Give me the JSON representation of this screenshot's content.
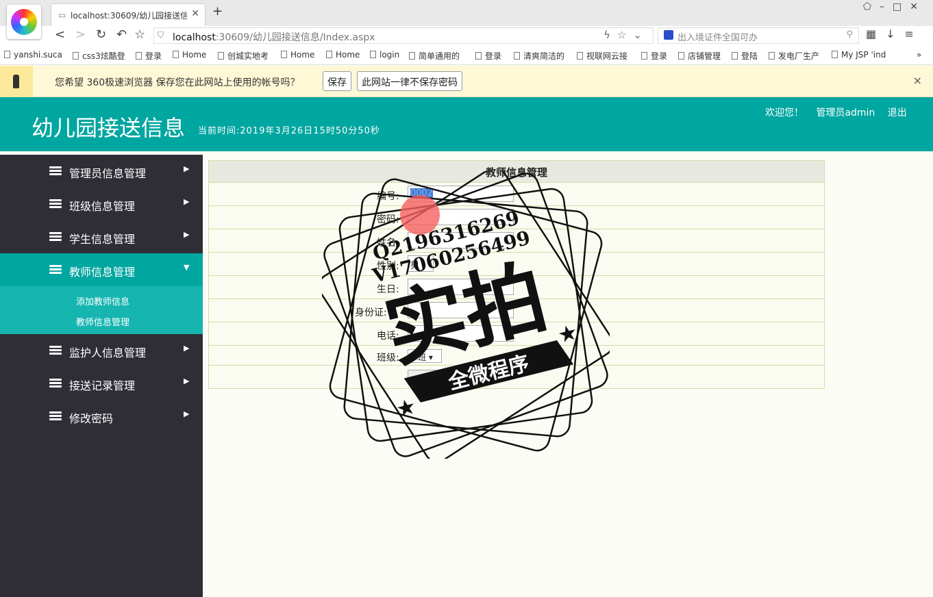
{
  "browser": {
    "tab_title": "localhost:30609/幼儿园接送信息",
    "new_tab": "+",
    "url_host": "localhost",
    "url_rest": ":30609/幼儿园接送信息/Index.aspx",
    "search_placeholder": "出入境证件全国可办",
    "bookmarks": [
      "yanshi.suca",
      "css3炫酷登",
      "登录",
      "Home",
      "创城实地考",
      "Home",
      "Home",
      "login",
      "简单通用的",
      "登录",
      "清爽简洁的",
      "视联网云接",
      "登录",
      "店铺管理",
      "登陆",
      "发电厂生产",
      "My JSP 'ind"
    ],
    "bookmark_more": "»",
    "password_prompt": {
      "message": "您希望 360极速浏览器 保存您在此网站上使用的帐号吗？",
      "save": "保存",
      "never": "此网站一律不保存密码",
      "close": "×"
    }
  },
  "header": {
    "title": "幼儿园接送信息",
    "clock": "当前时间:2019年3月26日15时50分50秒",
    "welcome": "欢迎您！",
    "admin": "管理员admin",
    "logout": "退出"
  },
  "sidebar": {
    "items": [
      {
        "label": "管理员信息管理",
        "arrow": "▶"
      },
      {
        "label": "班级信息管理",
        "arrow": "▶"
      },
      {
        "label": "学生信息管理",
        "arrow": "▶"
      },
      {
        "label": "教师信息管理",
        "arrow": "▼"
      },
      {
        "label": "监护人信息管理",
        "arrow": "▶"
      },
      {
        "label": "接送记录管理",
        "arrow": "▶"
      },
      {
        "label": "修改密码",
        "arrow": "▶"
      }
    ],
    "submenu": [
      "添加教师信息",
      "教师信息管理"
    ]
  },
  "panel": {
    "title": "教师信息管理",
    "fields": {
      "id": "编号:",
      "password": "密码:",
      "name": "姓名:",
      "gender": "性别:",
      "birthday": "生日:",
      "idcard": "身份证:",
      "phone": "电话:",
      "class": "班级:"
    },
    "values": {
      "id": "0002",
      "gender": "男",
      "class": "小班"
    }
  },
  "watermark": {
    "line1": "Q2196316269",
    "line2": "V17060256499",
    "big": "实拍",
    "ribbon": "全微程序"
  },
  "colors": {
    "accent": "#00a6a0",
    "sidebar": "#2f2d36",
    "submenu": "#16b5b0"
  }
}
